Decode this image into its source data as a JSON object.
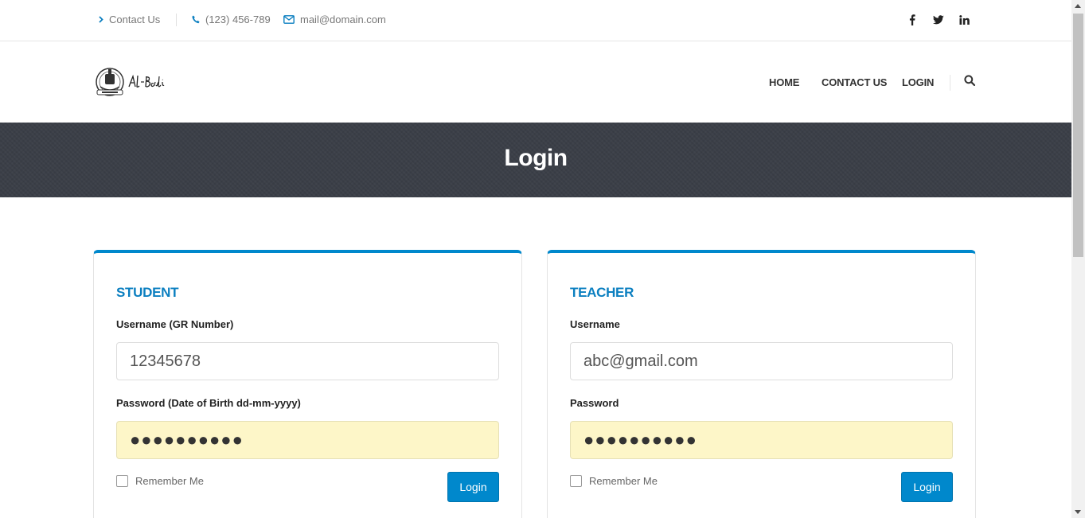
{
  "topbar": {
    "contact_label": "Contact Us",
    "phone": "(123) 456-789",
    "email": "mail@domain.com",
    "social_icons": [
      "facebook-icon",
      "twitter-icon",
      "linkedin-icon"
    ]
  },
  "header": {
    "logo_text": "Al-Bader",
    "nav": [
      "HOME",
      "CONTACT US",
      "LOGIN"
    ]
  },
  "page_title": "Login",
  "student": {
    "title": "STUDENT",
    "username_label": "Username (GR Number)",
    "username_value": "12345678",
    "password_label": "Password (Date of Birth dd-mm-yyyy)",
    "password_value": "●●●●●●●●●●",
    "remember_label": "Remember Me",
    "login_label": "Login"
  },
  "teacher": {
    "title": "TEACHER",
    "username_label": "Username",
    "username_value": "abc@gmail.com",
    "password_label": "Password",
    "password_value": "●●●●●●●●●●",
    "remember_label": "Remember Me",
    "login_label": "Login"
  },
  "colors": {
    "accent": "#0088cc",
    "band": "#3b3f48",
    "autofill": "#fdf6c8"
  }
}
